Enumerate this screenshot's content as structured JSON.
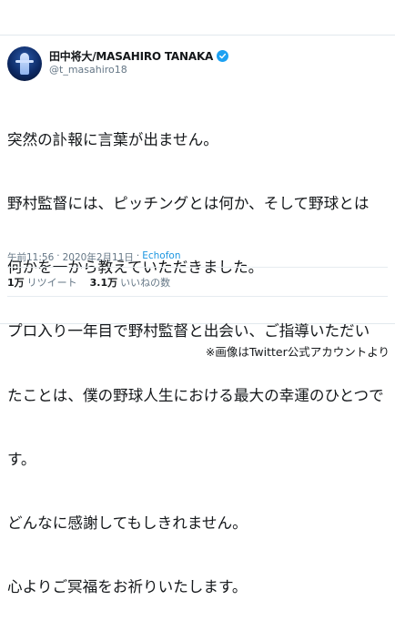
{
  "tweet": {
    "display_name": "田中将大/MASAHIRO TANAKA",
    "handle": "@t_masahiro18",
    "text_lines": [
      "突然の訃報に言葉が出ません。",
      "野村監督には、ピッチングとは何か、そして野球とは",
      "何かを一から教えていただきました。",
      "プロ入り一年目で野村監督と出会い、ご指導いただい",
      "たことは、僕の野球人生における最大の幸運のひとつで",
      "す。",
      "どんなに感謝してもしきれません。",
      "心よりご冥福をお祈りいたします。"
    ],
    "time": "午前11:56",
    "separator": "·",
    "date": "2020年2月11日",
    "separator2": "·",
    "source": "Echofon",
    "retweets_count": "1万",
    "retweets_label": "リツイート",
    "likes_count": "3.1万",
    "likes_label": "いいねの数",
    "verified_icon": "verified-badge-icon",
    "accent_color": "#1da1f2"
  },
  "credit": "※画像はTwitter公式アカウントより"
}
